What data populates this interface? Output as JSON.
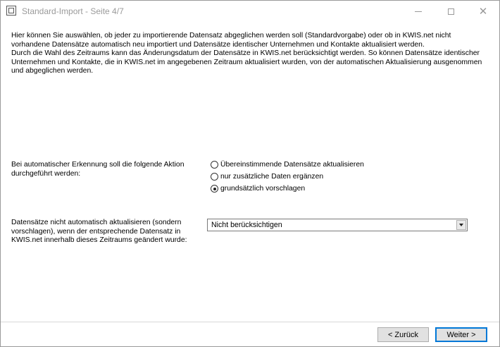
{
  "window": {
    "title": "Standard-Import - Seite 4/7"
  },
  "intro": {
    "paragraph1": "Hier können Sie auswählen, ob jeder zu importierende Datensatz abgeglichen werden soll (Standardvorgabe) oder ob in KWIS.net nicht vorhandene Datensätze automatisch neu importiert und Datensätze identischer Unternehmen und Kontakte aktualisiert werden.",
    "paragraph2": "Durch die Wahl des Zeitraums kann das Änderungsdatum der Datensätze in KWIS.net berücksichtigt werden. So können Datensätze identischer Unternehmen und Kontakte, die in KWIS.net im angegebenen Zeitraum aktualisiert wurden, von der automatischen Aktualisierung ausgenommen und abgeglichen werden."
  },
  "action": {
    "label": "Bei automatischer Erkennung soll die folgende Aktion durchgeführt werden:",
    "options": [
      {
        "label": "Übereinstimmende Datensätze aktualisieren",
        "checked": false
      },
      {
        "label": "nur zusätzliche Daten ergänzen",
        "checked": false
      },
      {
        "label": "grundsätzlich vorschlagen",
        "checked": true
      }
    ]
  },
  "period": {
    "label": "Datensätze nicht automatisch aktualisieren (sondern vorschlagen), wenn der entsprechende Datensatz in KWIS.net innerhalb dieses Zeitraums geändert wurde:",
    "selected": "Nicht berücksichtigen"
  },
  "buttons": {
    "back": "< Zurück",
    "next": "Weiter >"
  }
}
